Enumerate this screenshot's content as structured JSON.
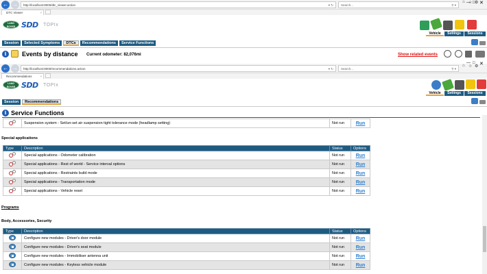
{
  "window1": {
    "url": "http://localhost:8000/dtc_viewer.action",
    "search_placeholder": "Search...",
    "tab_label": "DTC Viewer",
    "menu": [
      "Session",
      "Selected Symptoms",
      "DTCs",
      "Recommendations",
      "Service Functions"
    ],
    "menu_active": "DTCs",
    "brand": "SDD",
    "brand_sub": "TOPIx",
    "logo_text": "LAND ROVER",
    "nav_labels": [
      "Vehicle",
      "Settings",
      "Sessions"
    ],
    "title": "Events by distance",
    "odometer_label": "Current odometer:",
    "odometer_value": "82,076mi",
    "related_link": "Show related events"
  },
  "window2": {
    "url": "http://localhost:8000/recommendations.action",
    "search_placeholder": "Search...",
    "tab_label": "Recommendations",
    "menu": [
      "Session",
      "Recommendations"
    ],
    "menu_active": "Recommendations",
    "brand": "SDD",
    "brand_sub": "TOPIx",
    "logo_text": "LAND ROVER",
    "nav_labels": [
      "Vehicle",
      "Settings",
      "Sessions"
    ],
    "page_title": "Service Functions",
    "first_row": {
      "description": "Suspension system - Set/un-set air suspension tight tolerance mode (headlamp setting)",
      "status": "Not run",
      "option": "Run"
    },
    "section_special": "Special applications",
    "columns": [
      "Type",
      "Description",
      "Status",
      "Options"
    ],
    "special_rows": [
      {
        "description": "Special applications - Odometer calibration",
        "status": "Not run",
        "option": "Run"
      },
      {
        "description": "Special applications - Rest of world - Service interval options",
        "status": "Not run",
        "option": "Run"
      },
      {
        "description": "Special applications - Restraints build mode",
        "status": "Not run",
        "option": "Run"
      },
      {
        "description": "Special applications - Transportation mode",
        "status": "Not run",
        "option": "Run"
      },
      {
        "description": "Special applications - Vehicle reset",
        "status": "Not run",
        "option": "Run"
      }
    ],
    "programs_heading": "Programs",
    "section_body": "Body, Accessories, Security",
    "body_rows": [
      {
        "description": "Configure new modules - Driver's door module",
        "status": "Not run",
        "option": "Run"
      },
      {
        "description": "Configure new modules - Driver's seat module",
        "status": "Not run",
        "option": "Run"
      },
      {
        "description": "Configure new modules - Immobiliser antenna unit",
        "status": "Not run",
        "option": "Run"
      },
      {
        "description": "Configure new modules - Keyless vehicle module",
        "status": "Not run",
        "option": "Run"
      }
    ]
  }
}
